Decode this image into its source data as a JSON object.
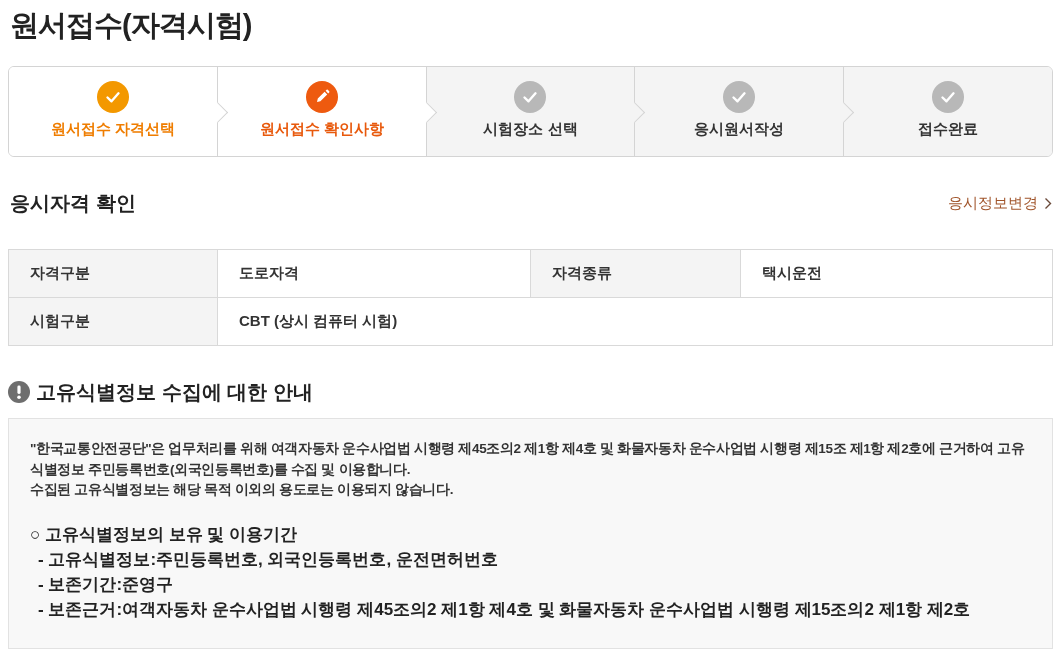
{
  "page_title": "원서접수(자격시험)",
  "steps": [
    {
      "label": "원서접수 자격선택",
      "completed": true,
      "selected": false
    },
    {
      "label": "원서접수 확인사항",
      "completed": false,
      "selected": true
    },
    {
      "label": "시험장소 선택",
      "completed": false,
      "selected": false
    },
    {
      "label": "응시원서작성",
      "completed": false,
      "selected": false
    },
    {
      "label": "접수완료",
      "completed": false,
      "selected": false
    }
  ],
  "qualification": {
    "title": "응시자격 확인",
    "link": "응시정보변경",
    "rows": [
      {
        "cells": [
          {
            "kind": "label",
            "text": "자격구분"
          },
          {
            "kind": "value",
            "text": "도로자격"
          },
          {
            "kind": "label",
            "text": "자격종류"
          },
          {
            "kind": "value",
            "text": "택시운전"
          }
        ]
      },
      {
        "cells": [
          {
            "kind": "label",
            "text": "시험구분"
          },
          {
            "kind": "value",
            "text": "CBT (상시 컴퓨터 시험)",
            "colspan": 3
          }
        ]
      }
    ]
  },
  "notice": {
    "title": "고유식별정보 수집에 대한 안내",
    "paragraphs": [
      "\"한국교통안전공단\"은 업무처리를 위해 여객자동차 운수사업법 시행령 제45조의2 제1항 제4호 및 화물자동차 운수사업법 시행령 제15조 제1항 제2호에 근거하여 고유식별정보 주민등록번호(외국인등록번호)를 수집 및 이용합니다.",
      "수집된 고유식별정보는 해당 목적 이외의 용도로는 이용되지 않습니다."
    ],
    "retention": {
      "title": "○ 고유식별정보의 보유 및 이용기간",
      "items": [
        "- 고유식별정보:주민등록번호, 외국인등록번호, 운전면허번호",
        "- 보존기간:준영구",
        "- 보존근거:여객자동차 운수사업법 시행령 제45조의2 제1항 제4호 및 화물자동차 운수사업법 시행령 제15조의2 제1항 제2호"
      ]
    }
  }
}
